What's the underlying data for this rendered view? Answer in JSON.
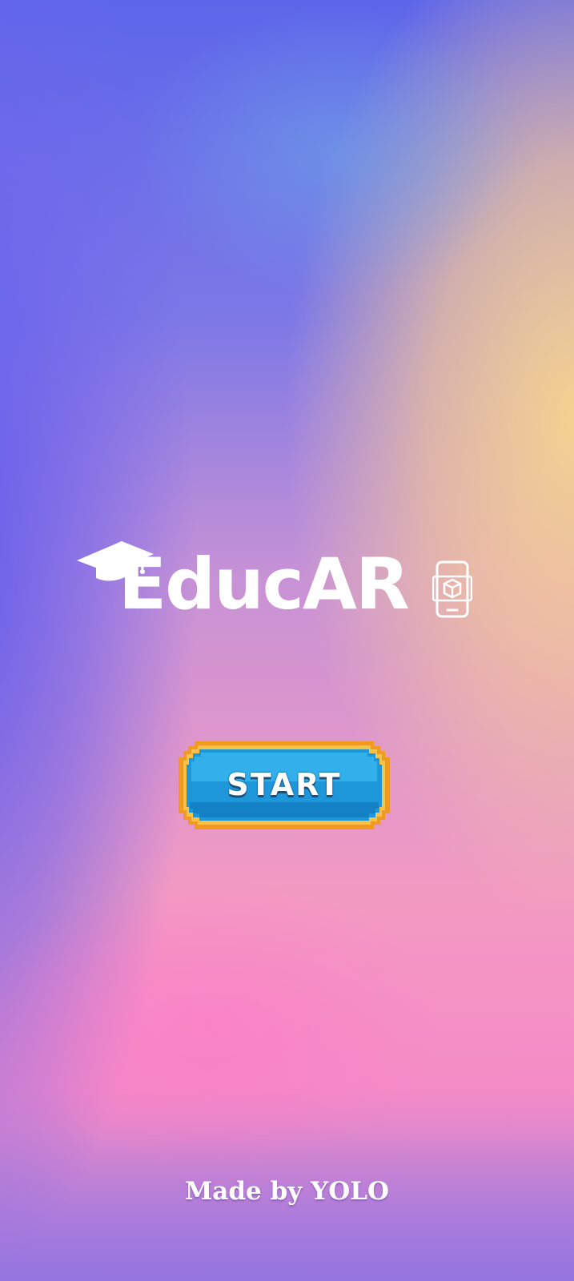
{
  "app": {
    "logo_text": "EducAR",
    "start_label": "START",
    "footer": "Made by YOLO"
  },
  "icons": {
    "cap": "graduation-cap-icon",
    "ar": "ar-phone-cube-icon"
  },
  "colors": {
    "button_blue": "#1f9fe2",
    "button_border": "#f3a12b",
    "text": "#ffffff"
  }
}
